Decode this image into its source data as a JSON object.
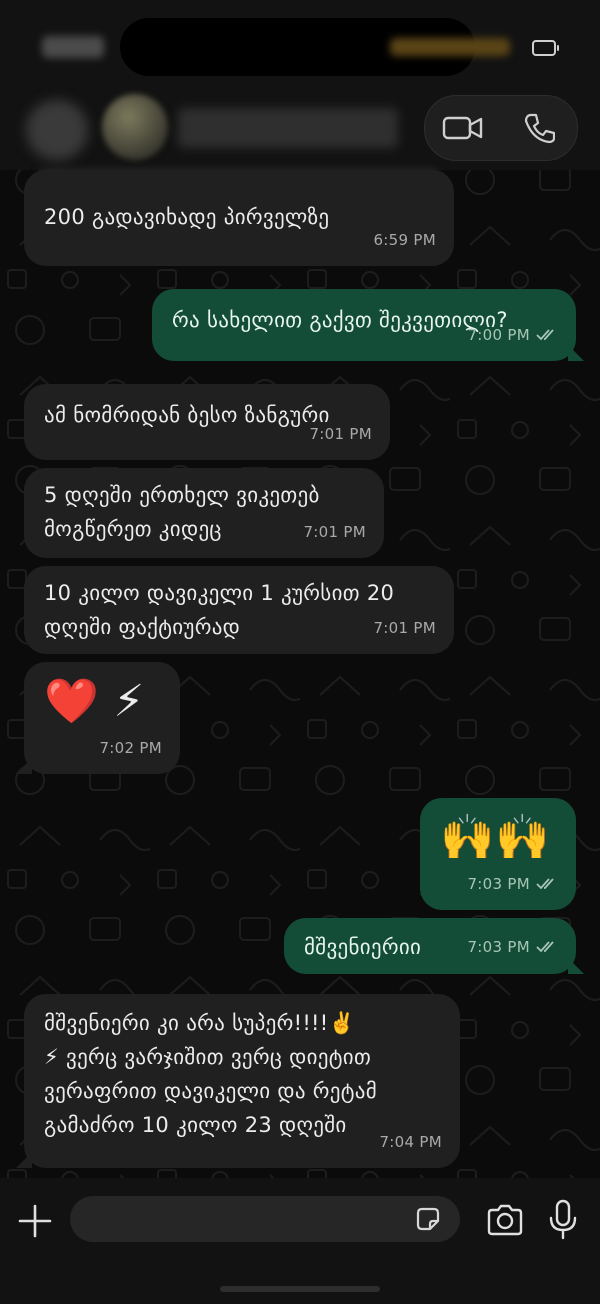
{
  "colors": {
    "background": "#0b0b0b",
    "incoming_bubble": "#202020",
    "outgoing_bubble": "#134d37",
    "header": "#121212"
  },
  "header": {
    "contact_name": "",
    "icons": [
      "video-call-icon",
      "voice-call-icon"
    ]
  },
  "messages": [
    {
      "dir": "in",
      "text": "200 გადავიხადე პირველზე",
      "time": "6:59 PM"
    },
    {
      "dir": "out",
      "text": "რა სახელით გაქვთ შეკვეთილი?",
      "time": "7:00 PM",
      "read": true
    },
    {
      "dir": "in",
      "text": "ამ ნომრიდან ბესო ზანგური",
      "time": "7:01 PM"
    },
    {
      "dir": "in",
      "line1": "5 დღეში ერთხელ ვიკეთებ",
      "line2": "მოგწერეთ კიდეც",
      "time": "7:01 PM"
    },
    {
      "dir": "in",
      "line1": "10 კილო დავიკელი 1 კურსით 20",
      "line2": "დღეში ფაქტიურად",
      "time": "7:01 PM"
    },
    {
      "dir": "in",
      "text": "❤️ ⚡",
      "time": "7:02 PM"
    },
    {
      "dir": "out",
      "text": "🙌🙌",
      "time": "7:03 PM",
      "read": true
    },
    {
      "dir": "out",
      "text": "მშვენიერიი",
      "time": "7:03 PM",
      "read": true
    },
    {
      "dir": "in",
      "line1": "მშვენიერი კი არა სუპერ!!!!✌️",
      "line2": "⚡ ვერც ვარჯიშით ვერც დიეტით",
      "line3": "ვერაფრით დავიკელი და რეტამ",
      "line4": "გამაძრო 10 კილო 23 დღეში",
      "time": "7:04 PM"
    }
  ],
  "composer": {
    "placeholder": "",
    "icons": [
      "plus-icon",
      "sticker-icon",
      "camera-icon",
      "microphone-icon"
    ]
  }
}
